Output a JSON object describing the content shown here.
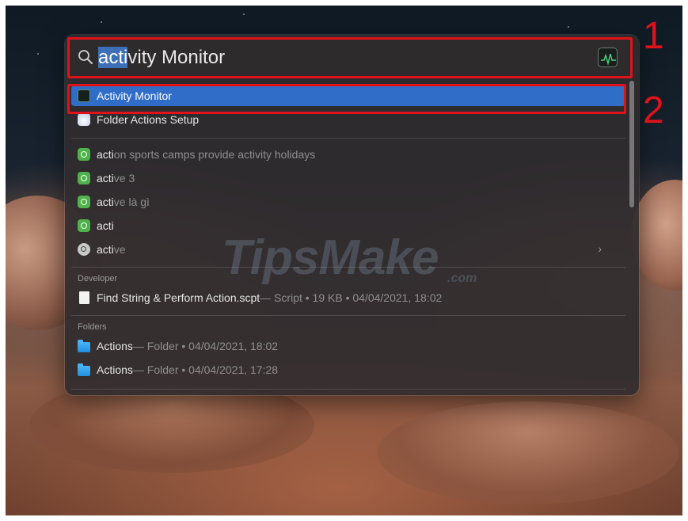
{
  "search": {
    "query_highlight": "acti",
    "query_rest": "vity Monitor"
  },
  "results": [
    {
      "bold": "Activity Monitor",
      "rest": "",
      "meta": "",
      "selected": true,
      "icon": "activity-monitor-icon"
    },
    {
      "bold": "Folder Actions Setup",
      "rest": "",
      "meta": "",
      "icon": "folder-actions-icon"
    }
  ],
  "suggestions": [
    {
      "bold": "acti",
      "rest": "on sports camps provide activity holidays",
      "icon": "search-suggestion-icon"
    },
    {
      "bold": "acti",
      "rest": "ve 3",
      "icon": "search-suggestion-icon"
    },
    {
      "bold": "acti",
      "rest": "ve là gì",
      "icon": "search-suggestion-icon"
    },
    {
      "bold": "acti",
      "rest": "",
      "icon": "search-suggestion-icon"
    },
    {
      "bold": "acti",
      "rest": "ve",
      "icon": "web-search-icon"
    }
  ],
  "developer": {
    "header": "Developer",
    "items": [
      {
        "name": "Find String & Perform Action.scpt",
        "meta": " — Script • 19 KB • 04/04/2021, 18:02",
        "icon": "script-document-icon"
      }
    ]
  },
  "folders": {
    "header": "Folders",
    "items": [
      {
        "name": "Actions",
        "meta": " — Folder • 04/04/2021, 18:02",
        "icon": "folder-icon"
      },
      {
        "name": "Actions",
        "meta": " — Folder • 04/04/2021, 17:28",
        "icon": "folder-icon"
      }
    ]
  },
  "annotations": {
    "label_1": "1",
    "label_2": "2",
    "color": "#e0121a"
  },
  "watermark": {
    "text": "TipsMake",
    "tld": ".com"
  },
  "colors": {
    "selection": "#2f6dc9",
    "panel": "#302c2e",
    "highlight": "#3d6fb6"
  }
}
